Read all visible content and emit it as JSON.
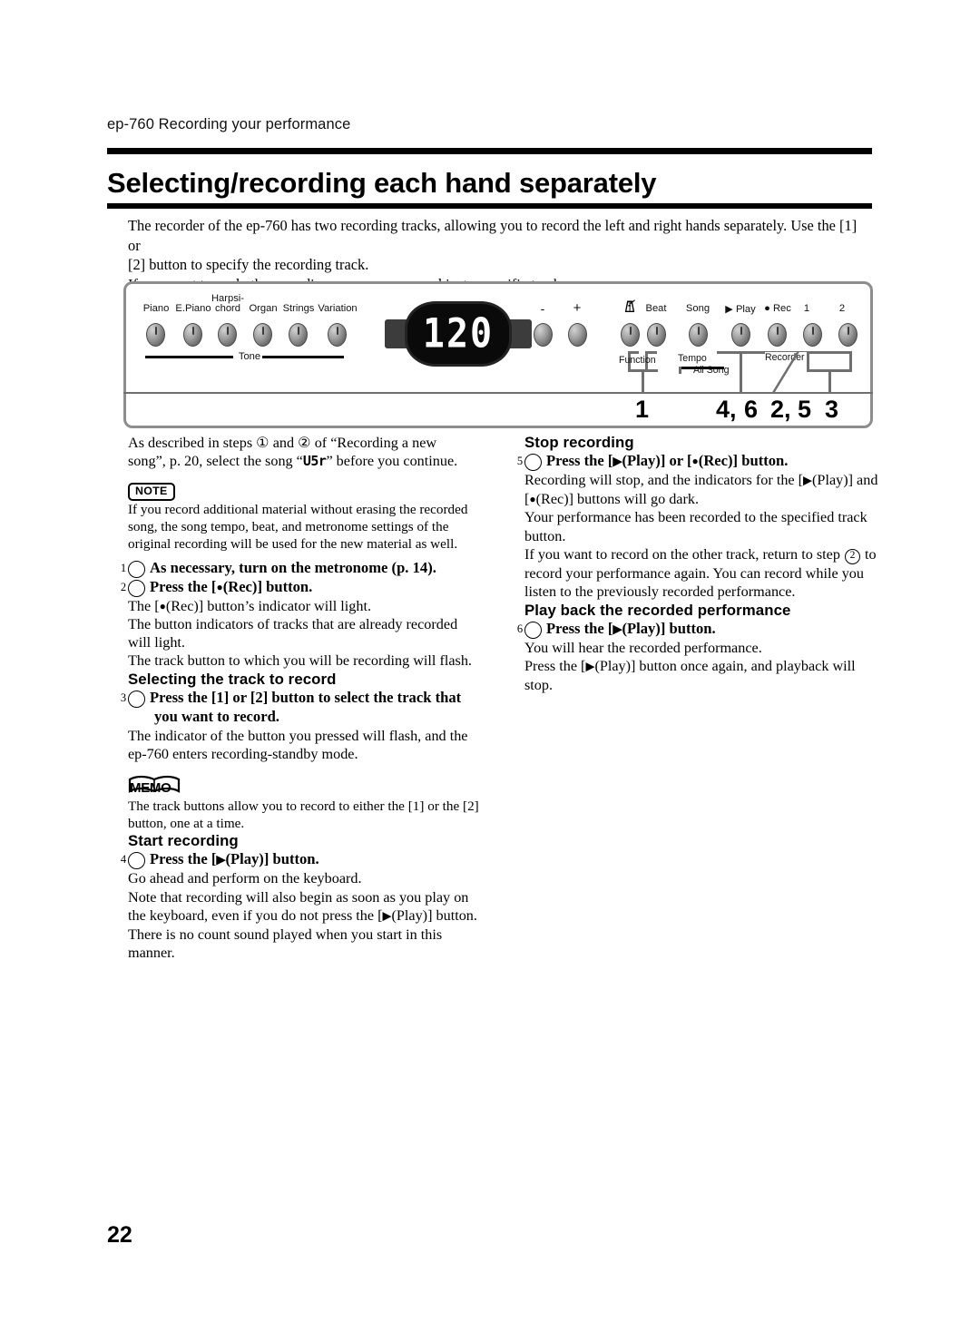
{
  "header": {
    "running_head": "ep-760 Recording your performance",
    "chapter_title": "Selecting/recording each hand separately"
  },
  "intro": {
    "line1": "The recorder of the ep-760 has two recording tracks, allowing you to record the left and right hands separately. Use the [1] or",
    "line2": "[2] button to specify the recording track.",
    "line3": "If you want to re-do the recording, you can re-record just a specific track."
  },
  "panel": {
    "display_value": "120",
    "tone_group_label": "Tone",
    "function_group_label": "Function",
    "tempo_group_label": "Tempo",
    "all_song_group_label": "All Song",
    "recorder_group_label": "Recorder",
    "tone_buttons": [
      {
        "label": "Piano"
      },
      {
        "label": "E.Piano"
      },
      {
        "label_line1": "Harpsi-",
        "label_line2": "chord"
      },
      {
        "label": "Organ"
      },
      {
        "label": "Strings"
      },
      {
        "label": "Variation"
      }
    ],
    "right_buttons": [
      {
        "label": "-"
      },
      {
        "label": "+"
      },
      {
        "label": "metronome-icon"
      },
      {
        "label": "Beat"
      },
      {
        "label": "Song"
      },
      {
        "label": "▶ Play"
      },
      {
        "label": "● Rec"
      },
      {
        "label": "1"
      },
      {
        "label": "2"
      }
    ],
    "callouts": [
      {
        "text": "1"
      },
      {
        "text": "4,"
      },
      {
        "text": "6"
      },
      {
        "text": "2,"
      },
      {
        "text": "5"
      },
      {
        "text": "3"
      }
    ]
  },
  "left_column": {
    "intro_line1": "As described in steps ① and ② of “Recording a new",
    "intro_line2_a": "song”, p. 20, select the song “",
    "intro_lcd": "U5r",
    "intro_line2_b": "” before you continue.",
    "note_label": "NOTE",
    "note_text": "If you record additional material without erasing the recorded song, the song tempo, beat, and metronome settings of the original recording will be used for the new material as well.",
    "step1": "As necessary, turn on the metronome (p. 14).",
    "step1_num": "1",
    "step2_a": "Press the [",
    "step2_b": "(Rec)] button.",
    "step2_num": "2",
    "step2_detail1_a": "The [",
    "step2_detail1_b": "(Rec)] button’s indicator will light.",
    "step2_detail2": "The button indicators of tracks that are already recorded will light.",
    "step2_detail3": "The track button to which you will be recording will flash.",
    "heading_select_track": "Selecting the track to record",
    "step3": "Press the [1] or [2] button to select the track that you want to record.",
    "step3_num": "3",
    "step3_detail": "The indicator of the button you pressed will flash, and the ep-760 enters recording-standby mode.",
    "memo_label": "MEMO",
    "memo_text": "The track buttons allow you to record to either the [1] or the [2] button, one at a time.",
    "heading_start_recording": "Start recording",
    "step4_a": "Press the [",
    "step4_b": "(Play)] button.",
    "step4_num": "4",
    "step4_detail1": "Go ahead and perform on the keyboard.",
    "step4_detail2_a": "Note that recording will also begin as soon as you play on the keyboard, even if you do not press the [",
    "step4_detail2_b": "(Play)] button. There is no count sound played when you start in this manner."
  },
  "right_column": {
    "heading_stop_recording": "Stop recording",
    "step5_a": "Press the [",
    "step5_b": "(Play)] or [",
    "step5_c": "(Rec)] button.",
    "step5_num": "5",
    "step5_detail1_a": "Recording will stop, and the indicators for the [",
    "step5_detail1_b": "(Play)] and [",
    "step5_detail1_c": "(Rec)] buttons will go dark.",
    "step5_detail2": "Your performance has been recorded to the specified track button.",
    "step5_detail3_a": "If you want to record on the other track, return to step",
    "step5_detail3_num": "2",
    "step5_detail3_b": "to record your performance again. You can record while you listen to the previously recorded performance.",
    "heading_play_back": "Play back the recorded performance",
    "step6_a": "Press the [",
    "step6_b": "(Play)] button.",
    "step6_num": "6",
    "step6_detail1": "You will hear the recorded performance.",
    "step6_detail2_a": "Press the [",
    "step6_detail2_b": "(Play)] button once again, and playback will stop."
  },
  "footer": {
    "page_number": "22"
  },
  "colors": {
    "rule": "#000000",
    "panel_border": "#8d8d8d",
    "button_body": "#8a8a8a",
    "led_bg": "#0a0a0a",
    "led_text": "#ffffff"
  }
}
